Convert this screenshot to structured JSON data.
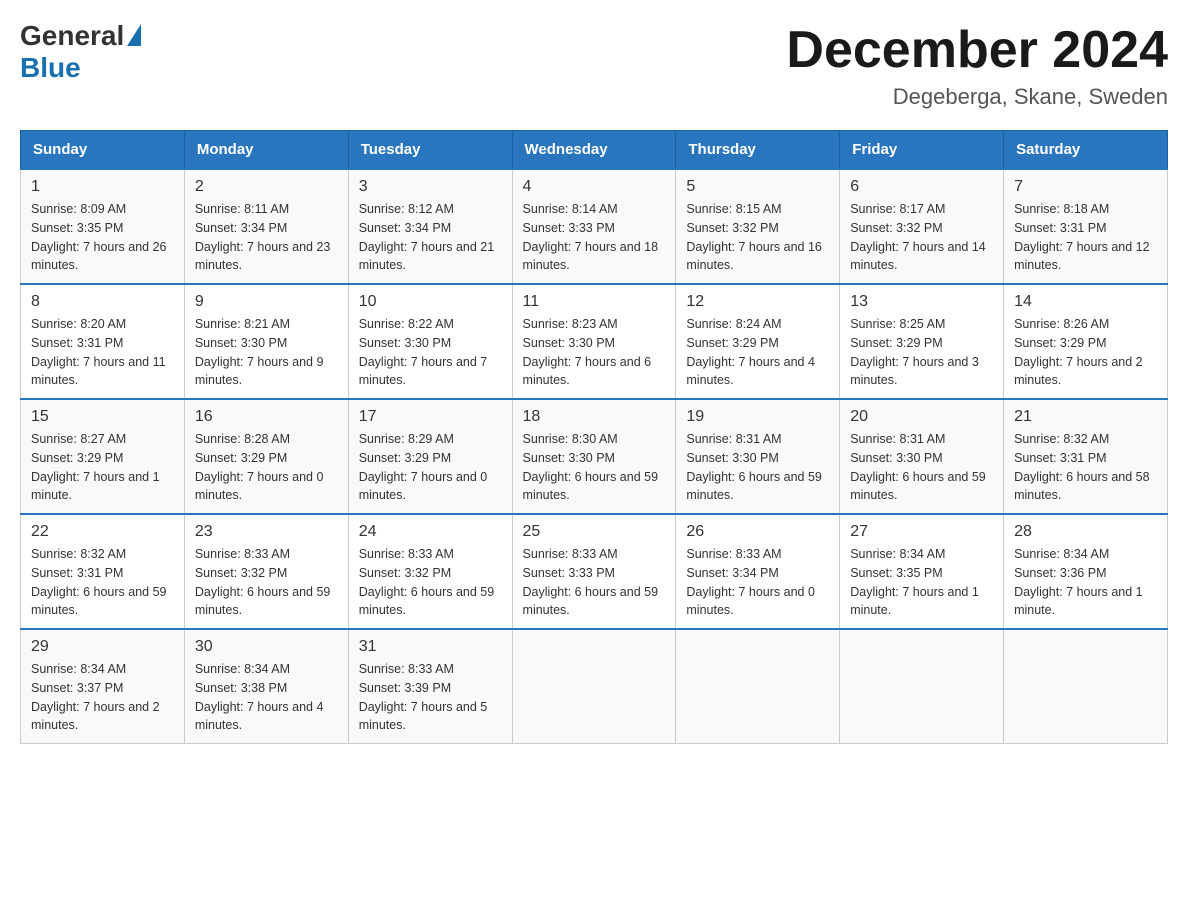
{
  "logo": {
    "general": "General",
    "blue": "Blue"
  },
  "header": {
    "month": "December 2024",
    "location": "Degeberga, Skane, Sweden"
  },
  "weekdays": [
    "Sunday",
    "Monday",
    "Tuesday",
    "Wednesday",
    "Thursday",
    "Friday",
    "Saturday"
  ],
  "weeks": [
    [
      {
        "day": "1",
        "sunrise": "8:09 AM",
        "sunset": "3:35 PM",
        "daylight": "7 hours and 26 minutes."
      },
      {
        "day": "2",
        "sunrise": "8:11 AM",
        "sunset": "3:34 PM",
        "daylight": "7 hours and 23 minutes."
      },
      {
        "day": "3",
        "sunrise": "8:12 AM",
        "sunset": "3:34 PM",
        "daylight": "7 hours and 21 minutes."
      },
      {
        "day": "4",
        "sunrise": "8:14 AM",
        "sunset": "3:33 PM",
        "daylight": "7 hours and 18 minutes."
      },
      {
        "day": "5",
        "sunrise": "8:15 AM",
        "sunset": "3:32 PM",
        "daylight": "7 hours and 16 minutes."
      },
      {
        "day": "6",
        "sunrise": "8:17 AM",
        "sunset": "3:32 PM",
        "daylight": "7 hours and 14 minutes."
      },
      {
        "day": "7",
        "sunrise": "8:18 AM",
        "sunset": "3:31 PM",
        "daylight": "7 hours and 12 minutes."
      }
    ],
    [
      {
        "day": "8",
        "sunrise": "8:20 AM",
        "sunset": "3:31 PM",
        "daylight": "7 hours and 11 minutes."
      },
      {
        "day": "9",
        "sunrise": "8:21 AM",
        "sunset": "3:30 PM",
        "daylight": "7 hours and 9 minutes."
      },
      {
        "day": "10",
        "sunrise": "8:22 AM",
        "sunset": "3:30 PM",
        "daylight": "7 hours and 7 minutes."
      },
      {
        "day": "11",
        "sunrise": "8:23 AM",
        "sunset": "3:30 PM",
        "daylight": "7 hours and 6 minutes."
      },
      {
        "day": "12",
        "sunrise": "8:24 AM",
        "sunset": "3:29 PM",
        "daylight": "7 hours and 4 minutes."
      },
      {
        "day": "13",
        "sunrise": "8:25 AM",
        "sunset": "3:29 PM",
        "daylight": "7 hours and 3 minutes."
      },
      {
        "day": "14",
        "sunrise": "8:26 AM",
        "sunset": "3:29 PM",
        "daylight": "7 hours and 2 minutes."
      }
    ],
    [
      {
        "day": "15",
        "sunrise": "8:27 AM",
        "sunset": "3:29 PM",
        "daylight": "7 hours and 1 minute."
      },
      {
        "day": "16",
        "sunrise": "8:28 AM",
        "sunset": "3:29 PM",
        "daylight": "7 hours and 0 minutes."
      },
      {
        "day": "17",
        "sunrise": "8:29 AM",
        "sunset": "3:29 PM",
        "daylight": "7 hours and 0 minutes."
      },
      {
        "day": "18",
        "sunrise": "8:30 AM",
        "sunset": "3:30 PM",
        "daylight": "6 hours and 59 minutes."
      },
      {
        "day": "19",
        "sunrise": "8:31 AM",
        "sunset": "3:30 PM",
        "daylight": "6 hours and 59 minutes."
      },
      {
        "day": "20",
        "sunrise": "8:31 AM",
        "sunset": "3:30 PM",
        "daylight": "6 hours and 59 minutes."
      },
      {
        "day": "21",
        "sunrise": "8:32 AM",
        "sunset": "3:31 PM",
        "daylight": "6 hours and 58 minutes."
      }
    ],
    [
      {
        "day": "22",
        "sunrise": "8:32 AM",
        "sunset": "3:31 PM",
        "daylight": "6 hours and 59 minutes."
      },
      {
        "day": "23",
        "sunrise": "8:33 AM",
        "sunset": "3:32 PM",
        "daylight": "6 hours and 59 minutes."
      },
      {
        "day": "24",
        "sunrise": "8:33 AM",
        "sunset": "3:32 PM",
        "daylight": "6 hours and 59 minutes."
      },
      {
        "day": "25",
        "sunrise": "8:33 AM",
        "sunset": "3:33 PM",
        "daylight": "6 hours and 59 minutes."
      },
      {
        "day": "26",
        "sunrise": "8:33 AM",
        "sunset": "3:34 PM",
        "daylight": "7 hours and 0 minutes."
      },
      {
        "day": "27",
        "sunrise": "8:34 AM",
        "sunset": "3:35 PM",
        "daylight": "7 hours and 1 minute."
      },
      {
        "day": "28",
        "sunrise": "8:34 AM",
        "sunset": "3:36 PM",
        "daylight": "7 hours and 1 minute."
      }
    ],
    [
      {
        "day": "29",
        "sunrise": "8:34 AM",
        "sunset": "3:37 PM",
        "daylight": "7 hours and 2 minutes."
      },
      {
        "day": "30",
        "sunrise": "8:34 AM",
        "sunset": "3:38 PM",
        "daylight": "7 hours and 4 minutes."
      },
      {
        "day": "31",
        "sunrise": "8:33 AM",
        "sunset": "3:39 PM",
        "daylight": "7 hours and 5 minutes."
      },
      null,
      null,
      null,
      null
    ]
  ],
  "labels": {
    "sunrise": "Sunrise:",
    "sunset": "Sunset:",
    "daylight": "Daylight:"
  }
}
